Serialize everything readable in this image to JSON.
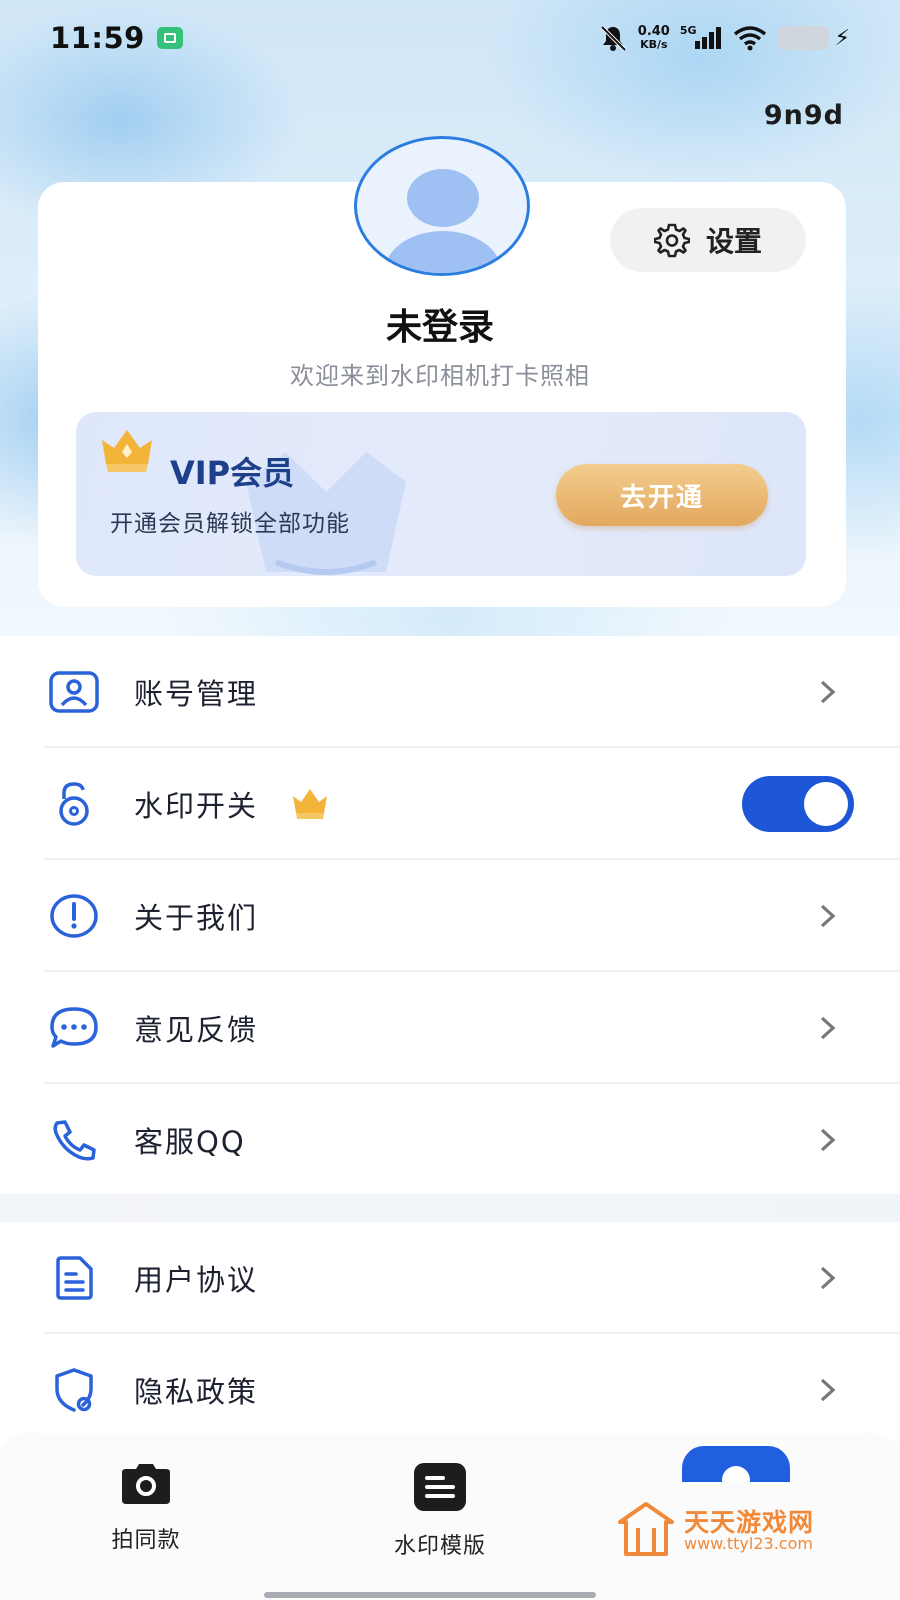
{
  "status_bar": {
    "time": "11:59",
    "net_speed_value": "0.40",
    "net_speed_unit": "KB/s",
    "signal_label": "5G"
  },
  "header": {
    "user_code": "9n9d"
  },
  "profile": {
    "settings_label": "设置",
    "user_name": "未登录",
    "welcome_text": "欢迎来到水印相机打卡照相"
  },
  "vip": {
    "title": "VIP会员",
    "subtitle": "开通会员解锁全部功能",
    "button_label": "去开通"
  },
  "menu": {
    "group1": [
      {
        "label": "账号管理",
        "icon": "account-icon"
      },
      {
        "label": "水印开关",
        "icon": "unlock-icon",
        "toggle_on": true
      },
      {
        "label": "关于我们",
        "icon": "info-icon"
      },
      {
        "label": "意见反馈",
        "icon": "chat-icon"
      },
      {
        "label": "客服QQ",
        "icon": "phone-icon"
      }
    ],
    "group2": [
      {
        "label": "用户协议",
        "icon": "document-icon"
      },
      {
        "label": "隐私政策",
        "icon": "shield-icon"
      }
    ]
  },
  "bottom_nav": {
    "items": [
      {
        "label": "拍同款",
        "icon": "camera-icon"
      },
      {
        "label": "水印模版",
        "icon": "template-icon"
      }
    ]
  },
  "watermark": {
    "site_name": "天天游戏网",
    "site_url": "www.ttyl23.com"
  },
  "colors": {
    "primary_blue": "#1d56d6",
    "icon_blue": "#2a62d9",
    "vip_gold": "#e2a85f",
    "vip_title": "#1e3f8a"
  }
}
